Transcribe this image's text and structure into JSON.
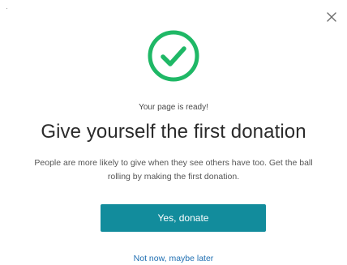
{
  "dialog": {
    "close_icon": "close-icon",
    "success_icon": "check-circle-icon",
    "accent_color": "#1fb866",
    "button_color": "#128c9c",
    "link_color": "#1f6fb2",
    "subtitle": "Your page is ready!",
    "title": "Give yourself the first donation",
    "description": "People are more likely to give when they see others have too. Get the ball rolling by making the first donation.",
    "primary_button_label": "Yes, donate",
    "secondary_link_label": "Not now, maybe later"
  }
}
